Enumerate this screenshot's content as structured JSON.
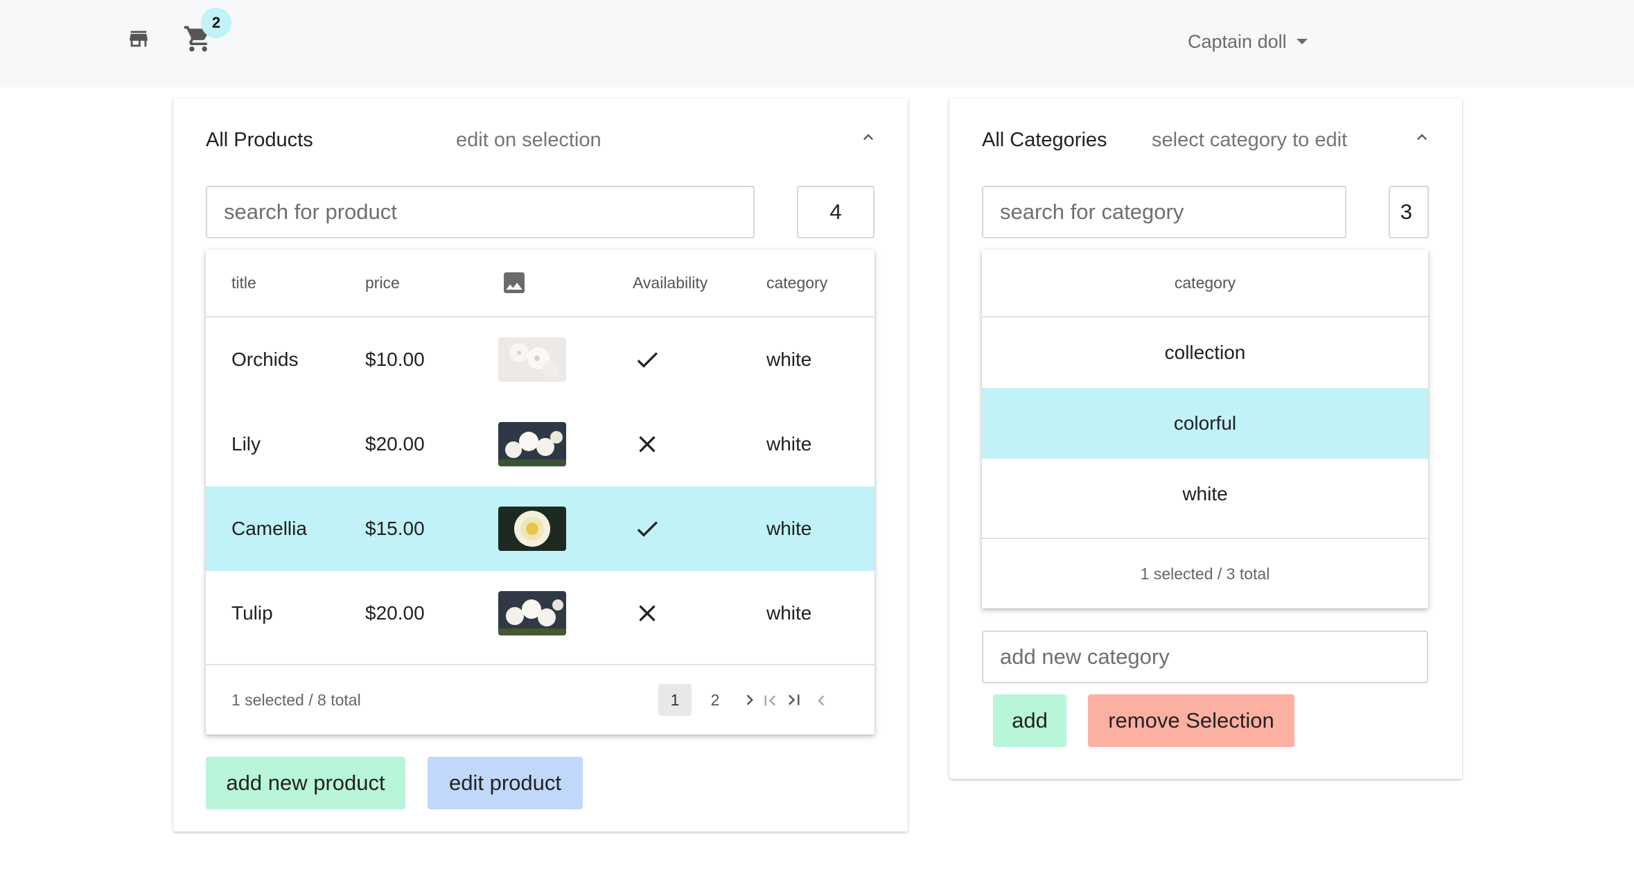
{
  "header": {
    "store_icon": "store-icon",
    "cart_icon": "cart-icon",
    "cart_count": "2",
    "user_name": "Captain doll"
  },
  "products": {
    "title": "All Products",
    "subtitle": "edit on selection",
    "search_placeholder": "search for product",
    "rows_per_page": "4",
    "columns": {
      "title": "title",
      "price": "price",
      "image_icon": "image-icon",
      "availability": "Availability",
      "category": "category"
    },
    "rows": [
      {
        "title": "Orchids",
        "price": "$10.00",
        "image": "orchid-photo",
        "available": true,
        "availability_icon": "check-icon",
        "category": "white",
        "selected": false
      },
      {
        "title": "Lily",
        "price": "$20.00",
        "image": "lily-photo",
        "available": false,
        "availability_icon": "close-icon",
        "category": "white",
        "selected": false
      },
      {
        "title": "Camellia",
        "price": "$15.00",
        "image": "camellia-photo",
        "available": true,
        "availability_icon": "check-icon",
        "category": "white",
        "selected": true
      },
      {
        "title": "Tulip",
        "price": "$20.00",
        "image": "tulip-photo",
        "available": false,
        "availability_icon": "close-icon",
        "category": "white",
        "selected": false
      }
    ],
    "footer_status": "1 selected / 8 total",
    "pagination": {
      "pages": [
        "1",
        "2"
      ],
      "current": "1"
    },
    "add_button": "add new product",
    "edit_button": "edit product"
  },
  "categories": {
    "title": "All Categories",
    "subtitle": "select category to edit",
    "search_placeholder": "search for category",
    "rows_per_page": "3",
    "column_header": "category",
    "rows": [
      {
        "name": "collection",
        "selected": false
      },
      {
        "name": "colorful",
        "selected": true
      },
      {
        "name": "white",
        "selected": false
      }
    ],
    "footer_status": "1 selected / 3 total",
    "new_category_placeholder": "add new category",
    "add_button": "add",
    "remove_button": "remove Selection"
  },
  "colors": {
    "selected_row": "#c1f2f7",
    "badge": "#c1f2f7",
    "add_green": "#b9f5d8",
    "edit_blue": "#c2d8fa",
    "remove_red": "#fcb0a2",
    "topbar_bg": "#f7f8fa"
  }
}
